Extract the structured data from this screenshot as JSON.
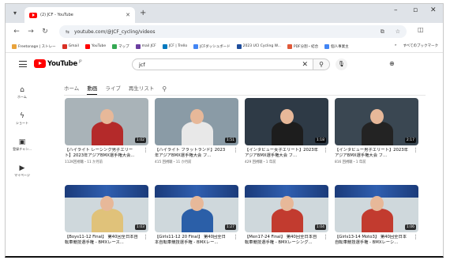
{
  "browser": {
    "tab_title": "(2) JCF - YouTube",
    "url": "youtube.com/@JCF_cycling/videos",
    "bookmarks": [
      {
        "label": "Freetonage | ストレー",
        "color": "#e9a33c"
      },
      {
        "label": "Gmail",
        "color": "#d93025"
      },
      {
        "label": "YouTube",
        "color": "#ff0000"
      },
      {
        "label": "マップ",
        "color": "#34a853"
      },
      {
        "label": "mail JCF",
        "color": "#6b3fa0"
      },
      {
        "label": "JCF | Trello",
        "color": "#0079bf"
      },
      {
        "label": "JCFダッシュボード",
        "color": "#4285f4"
      },
      {
        "label": "2023 UCI Cycling W...",
        "color": "#1f4e9c"
      },
      {
        "label": "PDF分割・結合",
        "color": "#e05a3a"
      },
      {
        "label": "個人事業主",
        "color": "#4285f4"
      }
    ],
    "bookmarks_more": "»",
    "all_bookmarks": "すべてのブックマーク"
  },
  "youtube": {
    "logo_text": "YouTube",
    "logo_region": "JP",
    "search_value": "jcf",
    "sidebar": [
      {
        "icon": "home-icon",
        "glyph": "⌂",
        "label": "ホーム"
      },
      {
        "icon": "shorts-icon",
        "glyph": "ϟ",
        "label": "ショート"
      },
      {
        "icon": "subscriptions-icon",
        "glyph": "▣",
        "label": "登録チャン..."
      },
      {
        "icon": "my-page-icon",
        "glyph": "▶",
        "label": "マイページ"
      }
    ],
    "channel_tabs": [
      "ホーム",
      "動画",
      "ライブ",
      "再生リスト"
    ],
    "active_tab": "動画"
  },
  "videos": [
    {
      "title": "【ハイライト レーシング男子エリート】2023年アジアBMX選手権大会...",
      "meta": "112K回視聴・11 か月前",
      "duration": "1:02",
      "bg": "#a9b3b8",
      "fig": "#b42a2a"
    },
    {
      "title": "【ハイライト フラットランド】2023年アジアBMX選手権大会 フ...",
      "meta": "415 回視聴・11 か月前",
      "duration": "1:51",
      "bg": "#8a9ba6",
      "fig": "#e8e8e8"
    },
    {
      "title": "【インタビュー女子エリート】2023年アジアBMX選手権大会 フ...",
      "meta": "429 回視聴・1 年前",
      "duration": "1:18",
      "bg": "#2e3a46",
      "fig": "#1d1d1d"
    },
    {
      "title": "【インタビュー男子エリート】2023年アジアBMX選手権大会 フ...",
      "meta": "816 回視聴・1 年前",
      "duration": "2:17",
      "bg": "#3a4752",
      "fig": "#232323"
    },
    {
      "title": "【Boys11-12 Final】 第40回全日本自転車競技選手権 - BMXレース...",
      "meta": "",
      "duration": "1:03",
      "bg": "#cfd8dc",
      "fig": "#e0c27a"
    },
    {
      "title": "【Girls11-12 20 Final】 第40回全日本自転車競技選手権 - BMXレー...",
      "meta": "",
      "duration": "1:27",
      "bg": "#cfd8dc",
      "fig": "#2b5fa8"
    },
    {
      "title": "【Men17-24 Final】 第40回全日本自転車競技選手権 - BMXレーシング...",
      "meta": "",
      "duration": "1:04",
      "bg": "#cfd8dc",
      "fig": "#c23b2f"
    },
    {
      "title": "【Girls13-14 Moto3】 第40回全日本自転車競技選手権 - BMXレーシ...",
      "meta": "",
      "duration": "1:06",
      "bg": "#cfd8dc",
      "fig": "#c23b2f"
    }
  ]
}
